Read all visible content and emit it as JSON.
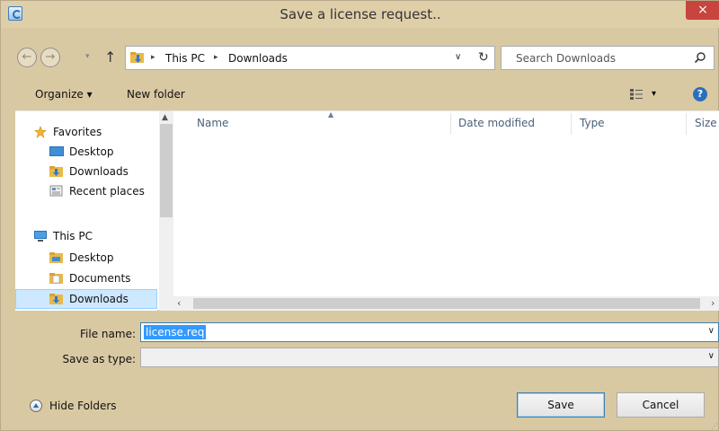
{
  "window": {
    "title": "Save a license request..",
    "close_label": "×"
  },
  "address": {
    "crumbs": [
      "This PC",
      "Downloads"
    ],
    "separator": "▸",
    "dropdown": "∨",
    "refresh": "↻"
  },
  "search": {
    "placeholder": "Search Downloads"
  },
  "nav_buttons": {
    "back": "←",
    "forward": "→",
    "recent": "▾",
    "up": "↑"
  },
  "toolbar": {
    "organize_label": "Organize ▾",
    "new_folder_label": "New folder",
    "view_drop": "▾",
    "help": "?"
  },
  "sidebar": {
    "items": [
      {
        "label": "Favorites",
        "icon": "star-icon",
        "selected": false
      },
      {
        "label": "Desktop",
        "icon": "desktop-icon",
        "selected": false
      },
      {
        "label": "Downloads",
        "icon": "downloads-folder-icon",
        "selected": false
      },
      {
        "label": "Recent places",
        "icon": "recent-places-icon",
        "selected": false
      },
      {
        "label": "This PC",
        "icon": "computer-icon",
        "selected": false
      },
      {
        "label": "Desktop",
        "icon": "folder-icon",
        "selected": false
      },
      {
        "label": "Documents",
        "icon": "documents-icon",
        "selected": false
      },
      {
        "label": "Downloads",
        "icon": "downloads-folder-icon",
        "selected": true
      }
    ]
  },
  "file_list": {
    "columns": [
      "Name",
      "Date modified",
      "Type",
      "Size"
    ],
    "sort_arrow": "▲",
    "rows": []
  },
  "scroll": {
    "up": "▲",
    "down": "∨",
    "left": "‹",
    "right": "›"
  },
  "form": {
    "file_name_label": "File name:",
    "file_name_value": "license.req",
    "save_type_label": "Save as type:",
    "save_type_value": "",
    "chevron": "∨"
  },
  "footer": {
    "hide_folders_label": "Hide Folders",
    "save_label": "Save",
    "cancel_label": "Cancel",
    "grip": "⋰"
  },
  "colors": {
    "frame": "#d9c9a3",
    "close": "#c7453e",
    "selection": "#3399ff",
    "nav_selected": "#cde8ff"
  }
}
